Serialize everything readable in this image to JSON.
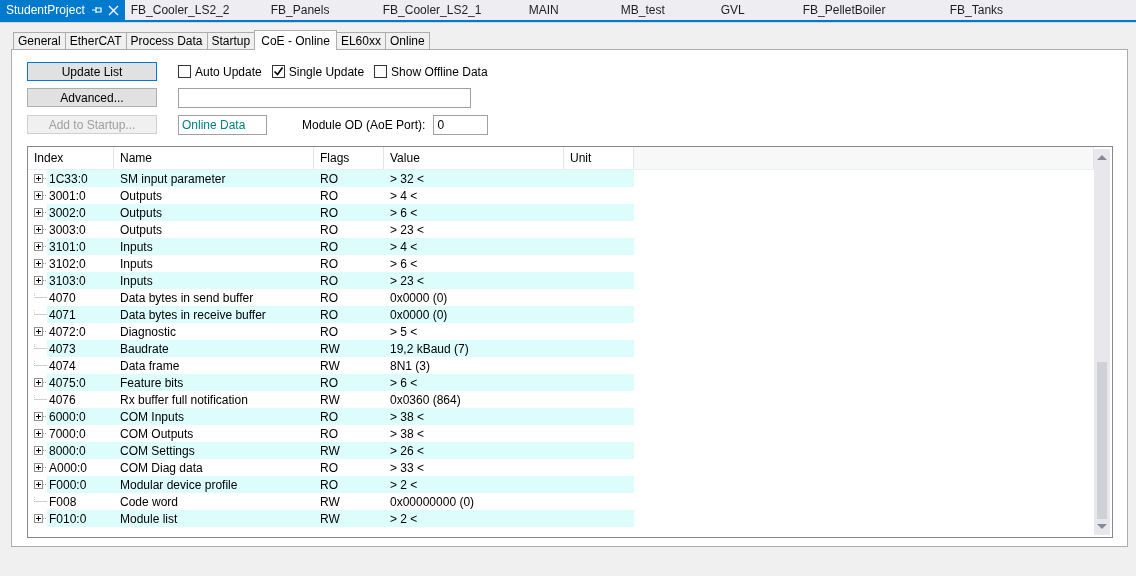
{
  "document_tabs": [
    {
      "label": "StudentProject",
      "selected": true
    },
    {
      "label": "FB_Cooler_LS2_2",
      "selected": false
    },
    {
      "label": "FB_Panels",
      "selected": false
    },
    {
      "label": "FB_Cooler_LS2_1",
      "selected": false
    },
    {
      "label": "MAIN",
      "selected": false
    },
    {
      "label": "MB_test",
      "selected": false
    },
    {
      "label": "GVL",
      "selected": false
    },
    {
      "label": "FB_PelletBoiler",
      "selected": false
    },
    {
      "label": "FB_Tanks",
      "selected": false
    }
  ],
  "tabs": [
    {
      "label": "General",
      "selected": false
    },
    {
      "label": "EtherCAT",
      "selected": false
    },
    {
      "label": "Process Data",
      "selected": false
    },
    {
      "label": "Startup",
      "selected": false
    },
    {
      "label": "CoE - Online",
      "selected": true
    },
    {
      "label": "EL60xx",
      "selected": false
    },
    {
      "label": "Online",
      "selected": false
    }
  ],
  "buttons": [
    {
      "label": "Update List",
      "disabled": false
    },
    {
      "label": "Advanced...",
      "disabled": false
    },
    {
      "label": "Add to Startup...",
      "disabled": true
    }
  ],
  "checkboxes": [
    {
      "label": "Auto Update",
      "checked": false
    },
    {
      "label": "Single Update",
      "checked": true
    },
    {
      "label": "Show Offline Data",
      "checked": false
    }
  ],
  "status_field": {
    "value": "Online Data"
  },
  "module_od": {
    "label": "Module OD (AoE Port):",
    "value": "0"
  },
  "table": {
    "columns": [
      "Index",
      "Name",
      "Flags",
      "Value",
      "Unit"
    ],
    "rows": [
      {
        "index": "1C33:0",
        "name": "SM input parameter",
        "flags": "RO",
        "value": "> 32 <",
        "expandable": true
      },
      {
        "index": "3001:0",
        "name": "Outputs",
        "flags": "RO",
        "value": "> 4 <",
        "expandable": true
      },
      {
        "index": "3002:0",
        "name": "Outputs",
        "flags": "RO",
        "value": "> 6 <",
        "expandable": true
      },
      {
        "index": "3003:0",
        "name": "Outputs",
        "flags": "RO",
        "value": "> 23 <",
        "expandable": true
      },
      {
        "index": "3101:0",
        "name": "Inputs",
        "flags": "RO",
        "value": "> 4 <",
        "expandable": true
      },
      {
        "index": "3102:0",
        "name": "Inputs",
        "flags": "RO",
        "value": "> 6 <",
        "expandable": true
      },
      {
        "index": "3103:0",
        "name": "Inputs",
        "flags": "RO",
        "value": "> 23 <",
        "expandable": true
      },
      {
        "index": "4070",
        "name": "Data bytes in send buffer",
        "flags": "RO",
        "value": "0x0000 (0)",
        "expandable": false
      },
      {
        "index": "4071",
        "name": "Data bytes in receive buffer",
        "flags": "RO",
        "value": "0x0000 (0)",
        "expandable": false
      },
      {
        "index": "4072:0",
        "name": "Diagnostic",
        "flags": "RO",
        "value": "> 5 <",
        "expandable": true
      },
      {
        "index": "4073",
        "name": "Baudrate",
        "flags": "RW",
        "value": "19,2 kBaud (7)",
        "expandable": false
      },
      {
        "index": "4074",
        "name": "Data frame",
        "flags": "RW",
        "value": "8N1 (3)",
        "expandable": false
      },
      {
        "index": "4075:0",
        "name": "Feature bits",
        "flags": "RO",
        "value": "> 6 <",
        "expandable": true
      },
      {
        "index": "4076",
        "name": "Rx buffer full notification",
        "flags": "RW",
        "value": "0x0360 (864)",
        "expandable": false
      },
      {
        "index": "6000:0",
        "name": "COM Inputs",
        "flags": "RO",
        "value": "> 38 <",
        "expandable": true
      },
      {
        "index": "7000:0",
        "name": "COM Outputs",
        "flags": "RO",
        "value": "> 38 <",
        "expandable": true
      },
      {
        "index": "8000:0",
        "name": "COM Settings",
        "flags": "RW",
        "value": "> 26 <",
        "expandable": true
      },
      {
        "index": "A000:0",
        "name": "COM Diag data",
        "flags": "RO",
        "value": "> 33 <",
        "expandable": true
      },
      {
        "index": "F000:0",
        "name": "Modular device profile",
        "flags": "RO",
        "value": "> 2 <",
        "expandable": true
      },
      {
        "index": "F008",
        "name": "Code word",
        "flags": "RW",
        "value": "0x00000000 (0)",
        "expandable": false
      },
      {
        "index": "F010:0",
        "name": "Module list",
        "flags": "RW",
        "value": "> 2 <",
        "expandable": true
      }
    ]
  }
}
